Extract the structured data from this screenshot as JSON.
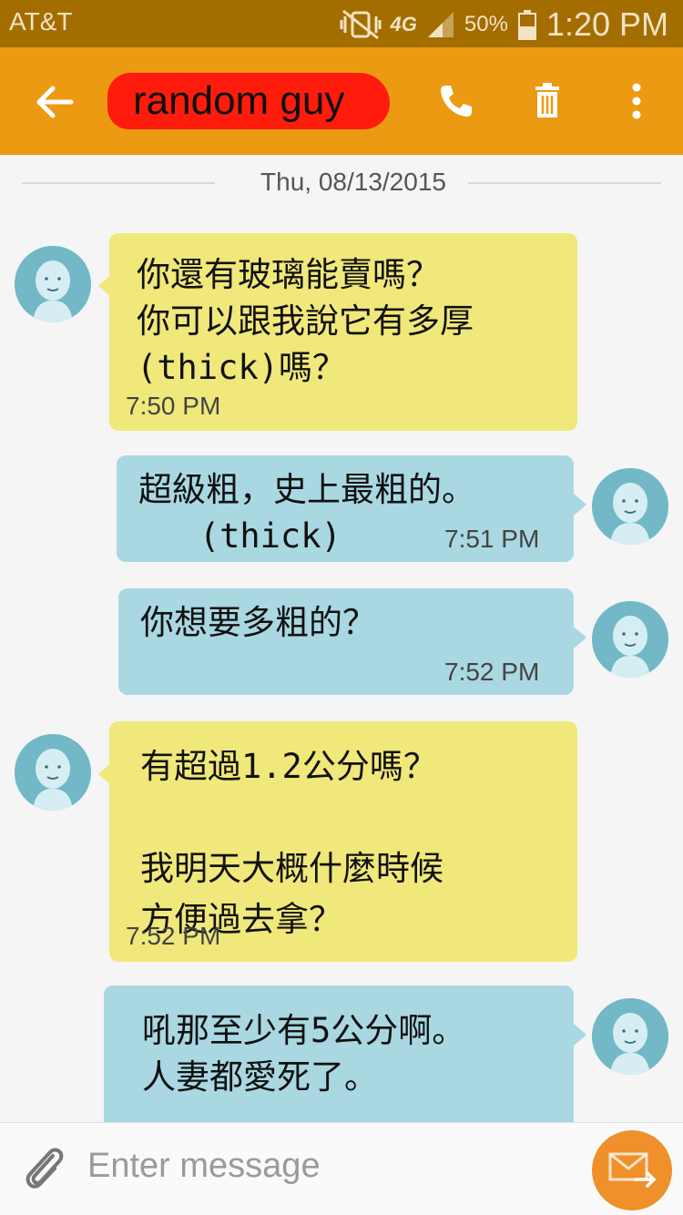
{
  "status_bar": {
    "carrier": "AT&T",
    "network": "4G",
    "battery": "50%",
    "time": "1:20 PM",
    "icons": [
      "vibrate-mute-icon",
      "signal-icon",
      "battery-icon"
    ]
  },
  "app_bar": {
    "contact_name": "random guy",
    "icons": [
      "back-arrow-icon",
      "phone-icon",
      "trash-icon",
      "more-vert-icon"
    ],
    "accent": "#eb9a12"
  },
  "conversation": {
    "date": "Thu, 08/13/2015",
    "messages": [
      {
        "direction": "incoming",
        "text": "你還有玻璃能賣嗎？\n你可以跟我說它有多厚\n(thick)嗎？",
        "time": "7:50 PM"
      },
      {
        "direction": "outgoing",
        "text": "超級粗，史上最粗的。\n   (thick)",
        "time": "7:51 PM"
      },
      {
        "direction": "outgoing",
        "text": "你想要多粗的？",
        "time": "7:52 PM"
      },
      {
        "direction": "incoming",
        "text": "有超過1.2公分嗎？\n\n我明天大概什麼時候\n方便過去拿？",
        "time": "7:52 PM"
      },
      {
        "direction": "outgoing",
        "text": "吼那至少有5公分啊。\n人妻都愛死了。",
        "time": ""
      }
    ],
    "colors": {
      "incoming": "#f0e87a",
      "outgoing": "#a9d8e2",
      "avatar": "#72b8c6"
    }
  },
  "composer": {
    "placeholder": "Enter message",
    "icons": [
      "paperclip-icon",
      "send-message-icon"
    ],
    "send_color": "#f0902a"
  }
}
